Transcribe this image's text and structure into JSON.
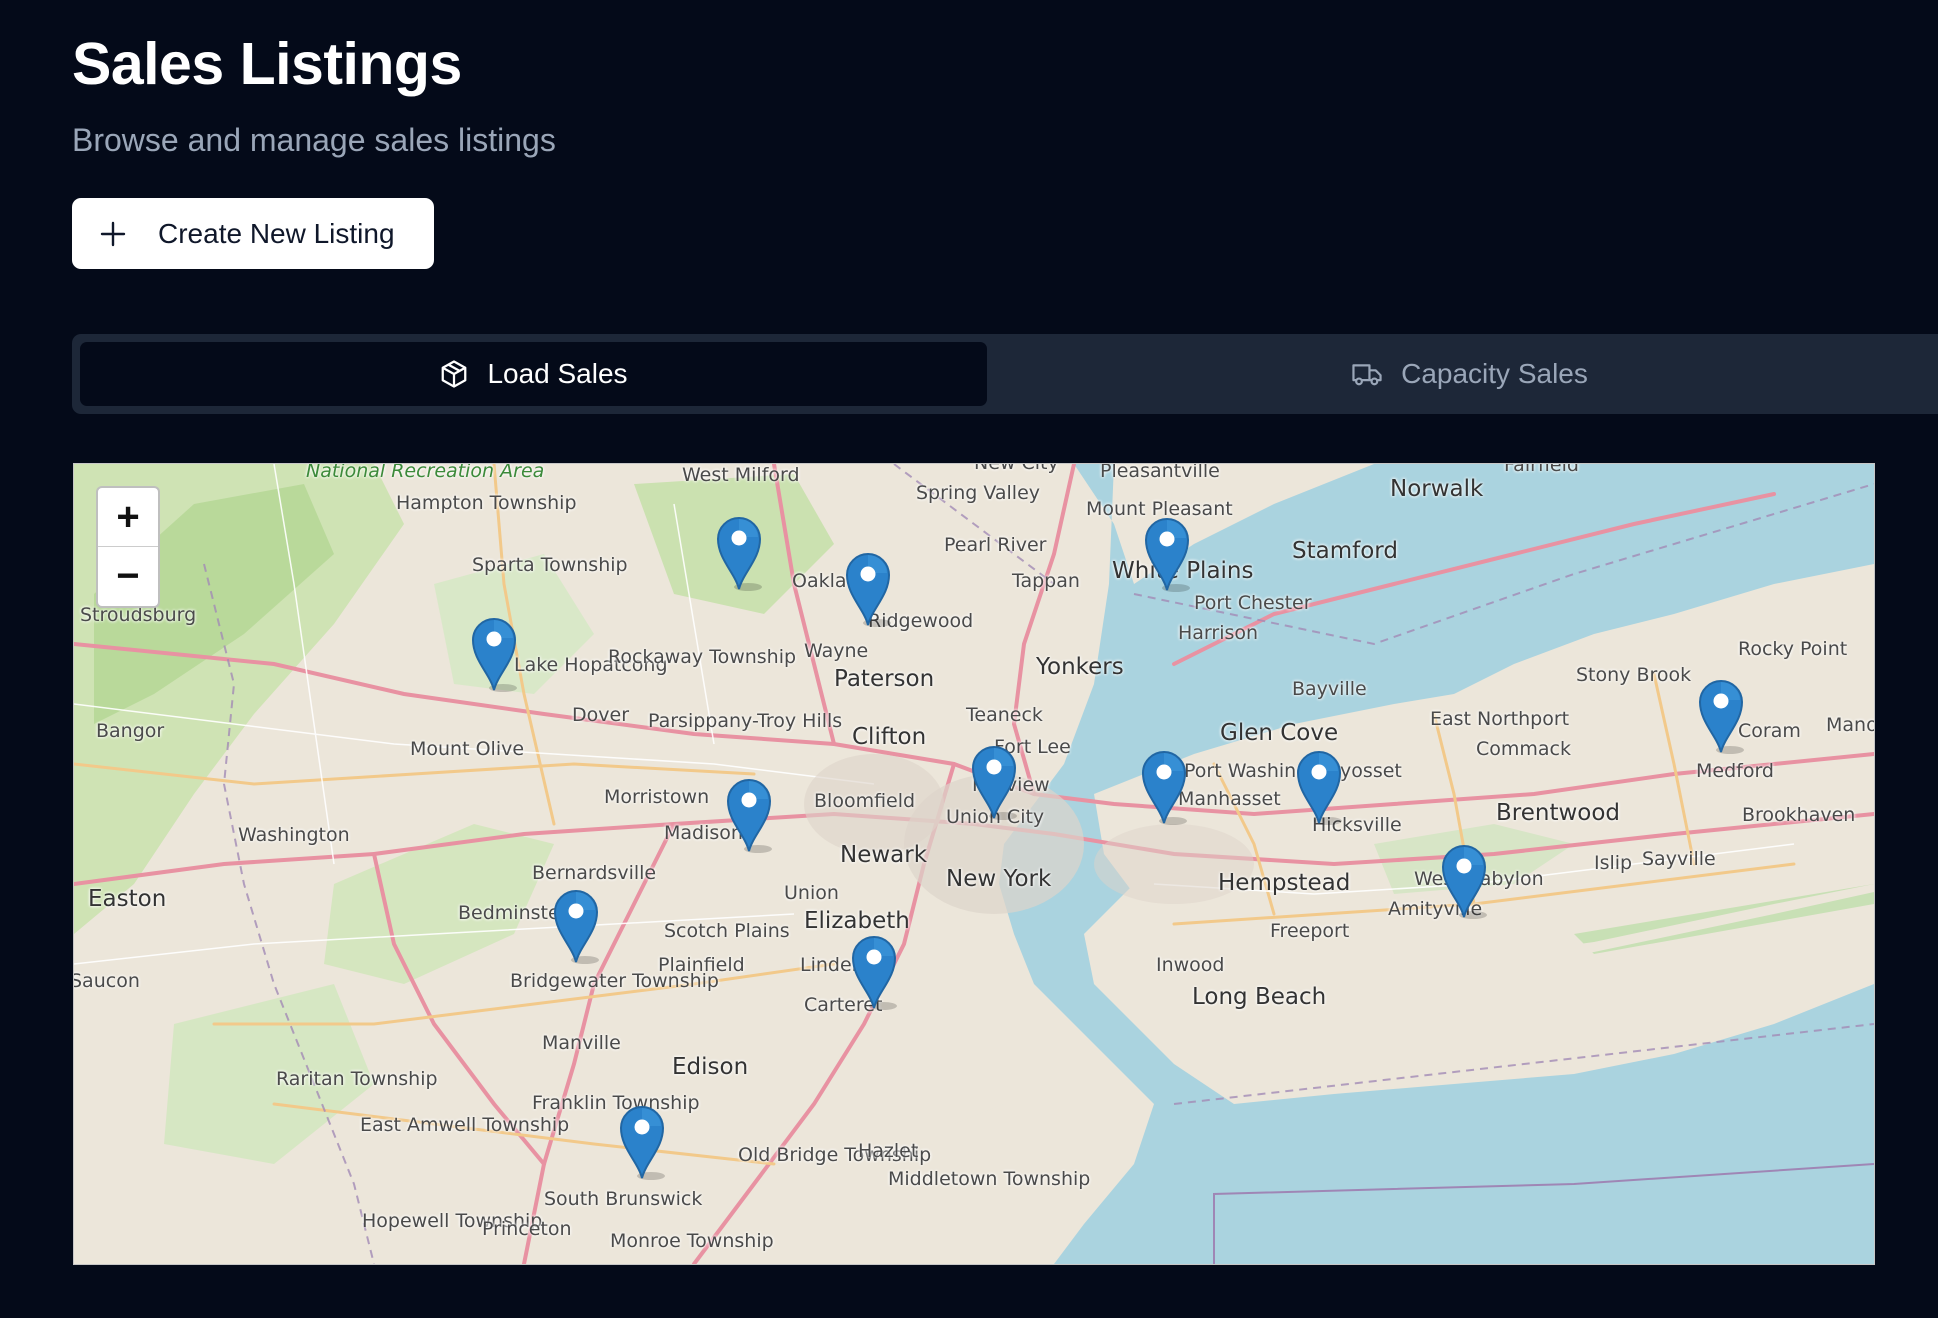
{
  "header": {
    "title": "Sales Listings",
    "subtitle": "Browse and manage sales listings"
  },
  "actions": {
    "create_label": "Create New Listing",
    "create_icon": "plus-icon"
  },
  "tabs": [
    {
      "label": "Load Sales",
      "icon": "package-icon",
      "active": true
    },
    {
      "label": "Capacity Sales",
      "icon": "truck-icon",
      "active": false
    }
  ],
  "map": {
    "zoom_in": "+",
    "zoom_out": "−",
    "marker_count": 13,
    "labels": [
      "National Recreation Area",
      "Hampton Township",
      "Sparta Township",
      "West Milford",
      "Spring Valley",
      "New City",
      "Pleasantville",
      "Mount Pleasant",
      "Norwalk",
      "Fairfield",
      "Pearl River",
      "Tappan",
      "White Plains",
      "Stamford",
      "Port Chester",
      "Harrison",
      "Oakland",
      "Ridgewood",
      "Wayne",
      "Paterson",
      "Stroudsburg",
      "Lake Hopatcong",
      "Rockaway Township",
      "Yonkers",
      "Rocky Point",
      "Stony Brook",
      "Bayville",
      "East Northport",
      "Bangor",
      "Dover",
      "Parsippany-Troy Hills",
      "Mount Olive",
      "Clifton",
      "Teaneck",
      "Fort Lee",
      "Glen Cove",
      "Commack",
      "Medford",
      "Washington",
      "Morristown",
      "Madison",
      "Bloomfield",
      "Fairview",
      "Union City",
      "Port Washington",
      "Manhasset",
      "Syosset",
      "Hicksville",
      "Brentwood",
      "Brookhaven",
      "Easton",
      "Bernardsville",
      "Newark",
      "New York",
      "Hempstead",
      "West Babylon",
      "Islip",
      "Sayville",
      "Amityville",
      "Bedminster",
      "Scotch Plains",
      "Elizabeth",
      "Union",
      "Freeport",
      "Plainfield",
      "Linden",
      "Bridgewater Township",
      "Inwood",
      "Long Beach",
      "Carteret",
      "Saucon",
      "Manville",
      "Edison",
      "Raritan Township",
      "Franklin Township",
      "East Amwell Township",
      "Old Bridge Township",
      "Hazlet",
      "Middletown Township",
      "South Brunswick",
      "Hopewell Township",
      "Princeton",
      "Monroe Township",
      "Coram",
      "Manorville"
    ]
  }
}
